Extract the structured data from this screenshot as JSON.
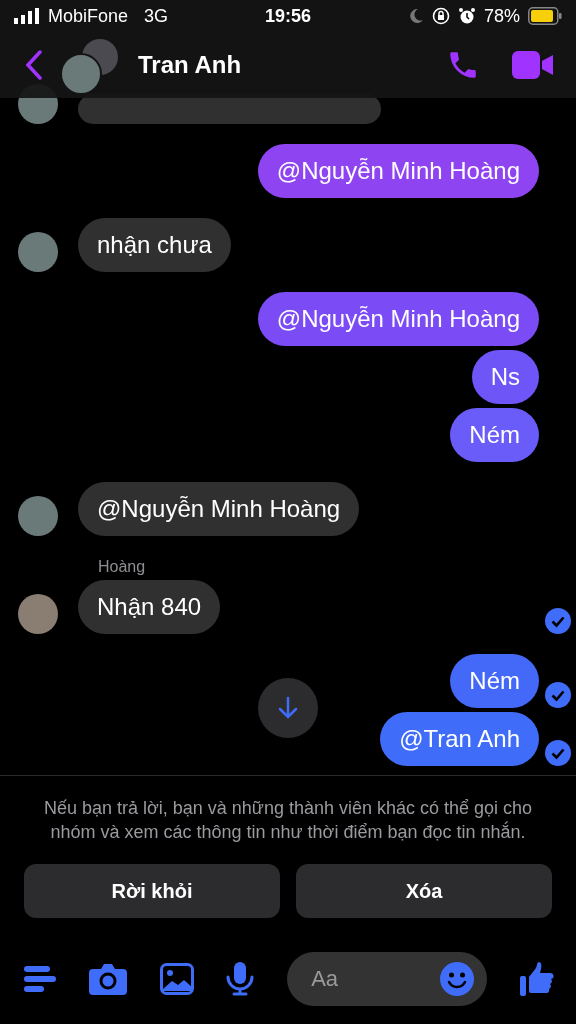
{
  "status_bar": {
    "carrier": "MobiFone",
    "network": "3G",
    "time": "19:56",
    "battery": "78%"
  },
  "header": {
    "title": "Tran Anh"
  },
  "messages": [
    {
      "kind": "incoming",
      "text": "nhận chưa",
      "avatar": true,
      "receipt": false
    },
    {
      "kind": "outgoing",
      "text": "@Nguyễn Minh Hoàng",
      "color": "#7b4bf5",
      "receipt": false
    },
    {
      "kind": "outgoing",
      "text": "Ns",
      "color": "#6e55f7",
      "receipt": false
    },
    {
      "kind": "outgoing",
      "text": "Ném",
      "color": "#6a5cf8",
      "receipt": false
    },
    {
      "kind": "incoming",
      "text": "@Nguyễn Minh Hoàng",
      "avatar": true,
      "receipt": false
    },
    {
      "kind": "incoming",
      "sender": "Hoàng",
      "text": "Nhận 840",
      "avatar": true,
      "receipt": true
    },
    {
      "kind": "outgoing",
      "text": "Ném",
      "color": "#4469f8",
      "receipt": true
    },
    {
      "kind": "outgoing",
      "text": "@Tran Anh",
      "color": "#3f6cf8",
      "receipt": true
    }
  ],
  "first_message": {
    "text": "@Nguyễn Minh Hoàng",
    "color": "#8f44f2"
  },
  "notice": {
    "text": "Nếu bạn trả lời, bạn và những thành viên khác có thể gọi cho nhóm và xem các thông tin như thời điểm bạn đọc tin nhắn.",
    "buttons": [
      "Rời khỏi",
      "Xóa"
    ]
  },
  "composer": {
    "placeholder": "Aa"
  }
}
